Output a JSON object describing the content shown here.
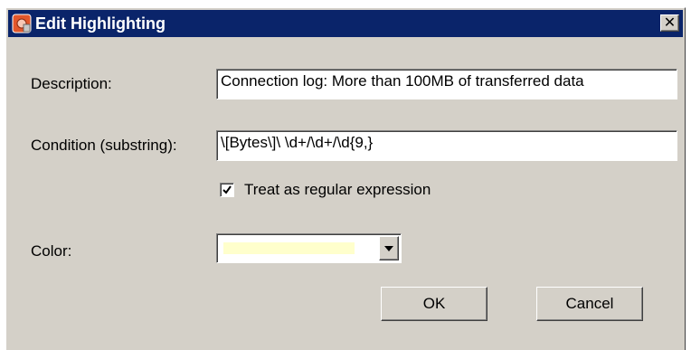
{
  "window": {
    "title": "Edit Highlighting",
    "close_glyph": "✕",
    "app_icon": "highlight-app-icon"
  },
  "form": {
    "description_label": "Description:",
    "description_value": "Connection log: More than 100MB of transferred data",
    "condition_label": "Condition (substring):",
    "condition_value": "\\[Bytes\\]\\ \\d+/\\d+/\\d{9,}",
    "regex_label": "Treat as regular expression",
    "regex_checked": true,
    "regex_check_glyph": "✔",
    "color_label": "Color:",
    "color_value": "#ffffcc"
  },
  "buttons": {
    "ok_label": "OK",
    "cancel_label": "Cancel"
  },
  "colors": {
    "titlebar": "#0a246a",
    "dialog_bg": "#d4d0c8"
  }
}
